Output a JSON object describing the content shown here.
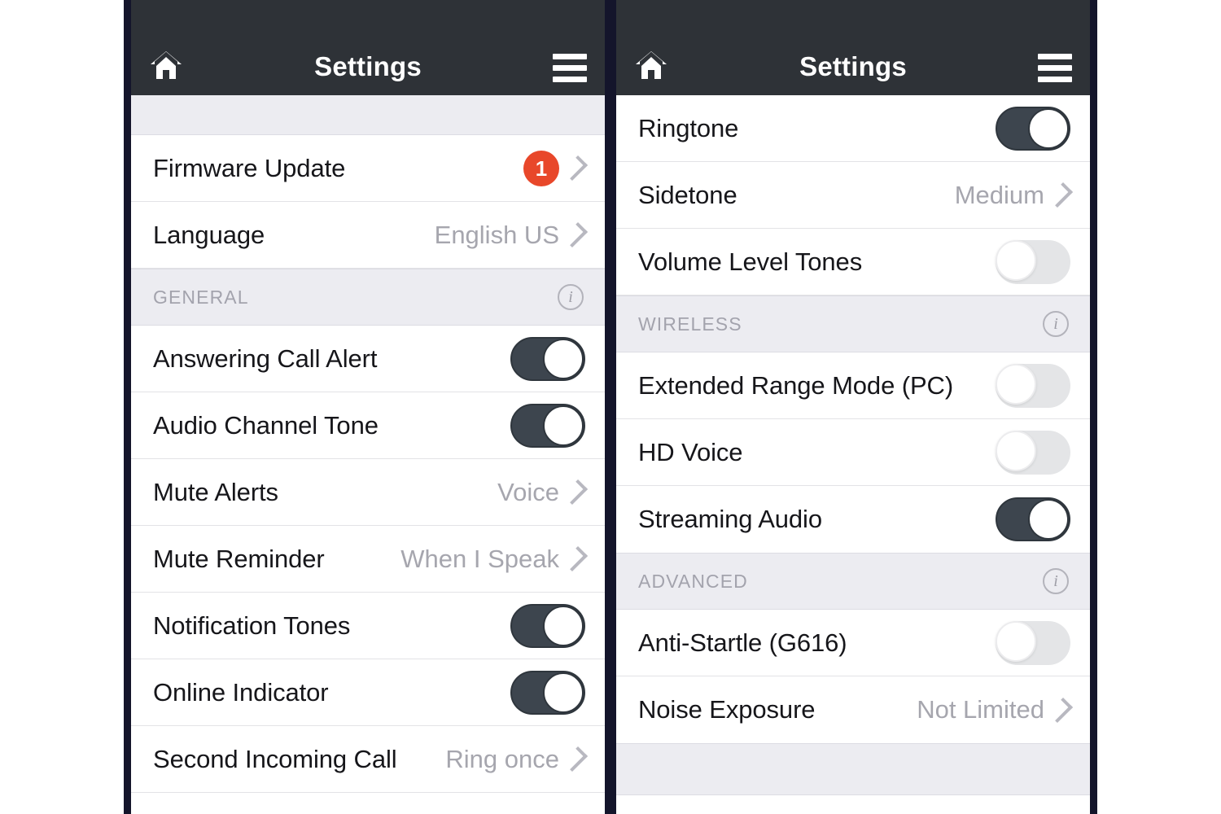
{
  "panels": [
    {
      "id": "left",
      "header": {
        "home_icon": "home-icon",
        "title": "Settings",
        "menu_icon": "hamburger-menu-icon"
      },
      "groups": [
        {
          "type": "partial-strip",
          "rows": [
            {
              "label": "Firmware Update",
              "control": "chevron",
              "badge": "1"
            },
            {
              "label": "Language",
              "control": "chevron",
              "value": "English US"
            }
          ]
        },
        {
          "type": "section",
          "section_label": "GENERAL",
          "info_icon": "info-icon",
          "rows": [
            {
              "label": "Answering Call Alert",
              "control": "toggle",
              "state": "on"
            },
            {
              "label": "Audio Channel Tone",
              "control": "toggle",
              "state": "on"
            },
            {
              "label": "Mute Alerts",
              "control": "chevron",
              "value": "Voice"
            },
            {
              "label": "Mute Reminder",
              "control": "chevron",
              "value": "When I Speak"
            },
            {
              "label": "Notification Tones",
              "control": "toggle",
              "state": "on"
            },
            {
              "label": "Online Indicator",
              "control": "toggle",
              "state": "on"
            },
            {
              "label": "Second Incoming Call",
              "control": "chevron",
              "value": "Ring once"
            }
          ]
        }
      ]
    },
    {
      "id": "right",
      "header": {
        "home_icon": "home-icon",
        "title": "Settings",
        "menu_icon": "hamburger-menu-icon"
      },
      "groups": [
        {
          "type": "continued",
          "rows": [
            {
              "label": "Ringtone",
              "control": "toggle",
              "state": "on"
            },
            {
              "label": "Sidetone",
              "control": "chevron",
              "value": "Medium"
            },
            {
              "label": "Volume Level Tones",
              "control": "toggle",
              "state": "off"
            }
          ]
        },
        {
          "type": "section",
          "section_label": "WIRELESS",
          "info_icon": "info-icon",
          "rows": [
            {
              "label": "Extended Range Mode (PC)",
              "control": "toggle",
              "state": "off"
            },
            {
              "label": "HD Voice",
              "control": "toggle",
              "state": "off"
            },
            {
              "label": "Streaming Audio",
              "control": "toggle",
              "state": "on"
            }
          ]
        },
        {
          "type": "section",
          "section_label": "ADVANCED",
          "info_icon": "info-icon",
          "rows": [
            {
              "label": "Anti-Startle (G616)",
              "control": "toggle",
              "state": "off"
            },
            {
              "label": "Noise Exposure",
              "control": "chevron",
              "value": "Not Limited"
            }
          ]
        }
      ]
    }
  ],
  "colors": {
    "header_bg": "#2e3237",
    "badge": "#e8472a",
    "toggle_on": "#3d454e",
    "toggle_off": "#e4e5e7",
    "section_bg": "#ececf1",
    "bezel": "#14152b"
  }
}
